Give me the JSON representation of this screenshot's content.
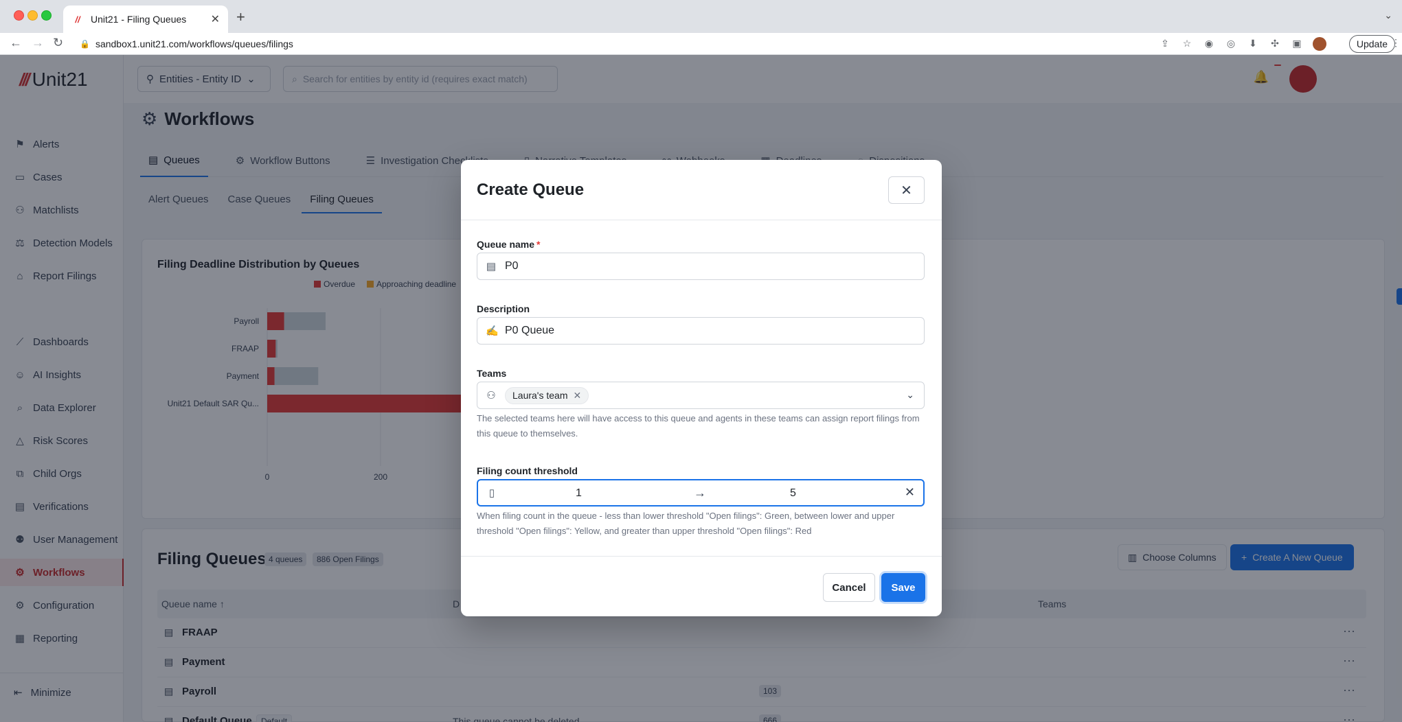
{
  "browser": {
    "tab_title": "Unit21 - Filing Queues",
    "url": "sandbox1.unit21.com/workflows/queues/filings",
    "update_label": "Update"
  },
  "sidebar": {
    "logo_text": "Unit21",
    "items": [
      {
        "label": "Alerts",
        "icon": "flag-icon"
      },
      {
        "label": "Cases",
        "icon": "briefcase-icon"
      },
      {
        "label": "Matchlists",
        "icon": "user-plus-icon"
      },
      {
        "label": "Detection Models",
        "icon": "scale-icon"
      },
      {
        "label": "Report Filings",
        "icon": "building-icon"
      },
      {
        "label": "Dashboards",
        "icon": "chart-line-icon"
      },
      {
        "label": "AI Insights",
        "icon": "robot-icon"
      },
      {
        "label": "Data Explorer",
        "icon": "search-list-icon"
      },
      {
        "label": "Risk Scores",
        "icon": "warning-icon"
      },
      {
        "label": "Child Orgs",
        "icon": "org-icon"
      },
      {
        "label": "Verifications",
        "icon": "id-card-icon"
      },
      {
        "label": "User Management",
        "icon": "user-gear-icon"
      },
      {
        "label": "Workflows",
        "icon": "workflow-icon"
      },
      {
        "label": "Configuration",
        "icon": "gear-icon"
      },
      {
        "label": "Reporting",
        "icon": "report-icon"
      }
    ],
    "minimize_label": "Minimize"
  },
  "topbar": {
    "entity_select": "Entities - Entity ID",
    "search_placeholder": "Search for entities by entity id (requires exact match)"
  },
  "page": {
    "title": "Workflows",
    "tabs": [
      "Queues",
      "Workflow Buttons",
      "Investigation Checklists",
      "Narrative Templates",
      "Webhooks",
      "Deadlines",
      "Dispositions"
    ],
    "sub_tabs": [
      "Alert Queues",
      "Case Queues",
      "Filing Queues"
    ]
  },
  "chart_data": {
    "type": "bar",
    "title": "Filing Deadline Distribution by Queues",
    "orientation": "horizontal",
    "stacked": true,
    "categories": [
      "Payroll",
      "FRAAP",
      "Payment",
      "Unit21 Default SAR Qu..."
    ],
    "series": [
      {
        "name": "Overdue",
        "color": "#e53935",
        "values": [
          30,
          15,
          13,
          420
        ]
      },
      {
        "name": "Approaching deadline",
        "color": "#f9a825",
        "values": [
          0,
          0,
          0,
          0
        ]
      },
      {
        "name": "",
        "color": "#cfd8dc",
        "values": [
          73,
          3,
          77,
          0
        ]
      }
    ],
    "xticks": [
      "0",
      "200"
    ],
    "xlim": [
      0,
      700
    ]
  },
  "table": {
    "title": "Filing Queues",
    "queues_badge": "4 queues",
    "open_badge": "886 Open Filings",
    "choose_columns": "Choose Columns",
    "create_new": "Create A New Queue",
    "headers": {
      "name": "Queue name",
      "desc": "D",
      "teams": "Teams"
    },
    "rows": [
      {
        "name": "FRAAP",
        "tag": "",
        "desc": "",
        "count": ""
      },
      {
        "name": "Payment",
        "tag": "",
        "desc": "",
        "count": ""
      },
      {
        "name": "Payroll",
        "tag": "",
        "desc": "",
        "count": "103"
      },
      {
        "name": "Default Queue",
        "tag": "Default",
        "desc": "This queue cannot be deleted",
        "count": "666"
      }
    ]
  },
  "modal": {
    "title": "Create Queue",
    "name_label": "Queue name",
    "name_required": "*",
    "name_value": "P0",
    "desc_label": "Description",
    "desc_value": "P0 Queue",
    "teams_label": "Teams",
    "team_chip": "Laura's team",
    "teams_help": "The selected teams here will have access to this queue and agents in these teams can assign report filings from this queue to themselves.",
    "threshold_label": "Filing count threshold",
    "threshold_lower": "1",
    "threshold_upper": "5",
    "threshold_help": "When filing count in the queue - less than lower threshold \"Open filings\": Green, between lower and upper threshold \"Open filings\": Yellow, and greater than upper threshold \"Open filings\": Red",
    "cancel_label": "Cancel",
    "save_label": "Save"
  }
}
